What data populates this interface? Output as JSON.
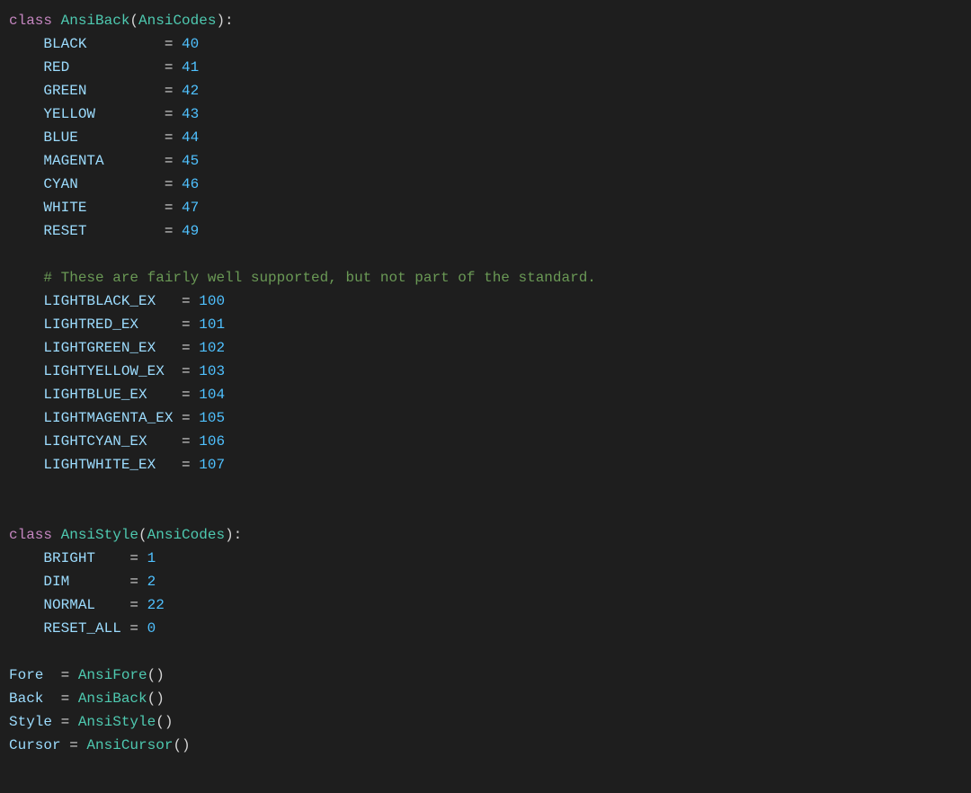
{
  "code": {
    "lines": [
      {
        "type": "class_def",
        "keyword": "class",
        "name": "AnsiBack",
        "parent": "AnsiCodes",
        "suffix": "):"
      },
      {
        "type": "attr",
        "name": "BLACK",
        "value": "40"
      },
      {
        "type": "attr",
        "name": "RED",
        "value": "41"
      },
      {
        "type": "attr",
        "name": "GREEN",
        "value": "42"
      },
      {
        "type": "attr",
        "name": "YELLOW",
        "value": "43"
      },
      {
        "type": "attr",
        "name": "BLUE",
        "value": "44"
      },
      {
        "type": "attr",
        "name": "MAGENTA",
        "value": "45"
      },
      {
        "type": "attr",
        "name": "CYAN",
        "value": "46"
      },
      {
        "type": "attr",
        "name": "WHITE",
        "value": "47"
      },
      {
        "type": "attr",
        "name": "RESET",
        "value": "49"
      },
      {
        "type": "empty"
      },
      {
        "type": "comment",
        "text": "# These are fairly well supported, but not part of the standard."
      },
      {
        "type": "attr",
        "name": "LIGHTBLACK_EX",
        "value": "100"
      },
      {
        "type": "attr",
        "name": "LIGHTRED_EX",
        "value": "101"
      },
      {
        "type": "attr",
        "name": "LIGHTGREEN_EX",
        "value": "102"
      },
      {
        "type": "attr",
        "name": "LIGHTYELLOW_EX",
        "value": "103"
      },
      {
        "type": "attr",
        "name": "LIGHTBLUE_EX",
        "value": "104"
      },
      {
        "type": "attr",
        "name": "LIGHTMAGENTA_EX",
        "value": "105"
      },
      {
        "type": "attr",
        "name": "LIGHTCYAN_EX",
        "value": "106"
      },
      {
        "type": "attr",
        "name": "LIGHTWHITE_EX",
        "value": "107"
      },
      {
        "type": "empty"
      },
      {
        "type": "empty"
      },
      {
        "type": "class_def",
        "keyword": "class",
        "name": "AnsiStyle",
        "parent": "AnsiCodes",
        "suffix": "):"
      },
      {
        "type": "attr",
        "name": "BRIGHT",
        "value": "1"
      },
      {
        "type": "attr",
        "name": "DIM",
        "value": "2"
      },
      {
        "type": "attr",
        "name": "NORMAL",
        "value": "22"
      },
      {
        "type": "attr",
        "name": "RESET_ALL",
        "value": "0"
      },
      {
        "type": "empty"
      },
      {
        "type": "instance",
        "var": "Fore",
        "class": "AnsiFore"
      },
      {
        "type": "instance",
        "var": "Back",
        "class": "AnsiBack"
      },
      {
        "type": "instance",
        "var": "Style",
        "class": "AnsiStyle"
      },
      {
        "type": "instance",
        "var": "Cursor",
        "class": "AnsiCursor"
      }
    ]
  },
  "colors": {
    "background": "#1e1e1e",
    "keyword_class": "#c586c0",
    "class_name": "#4ec9b0",
    "identifier": "#9cdcfe",
    "number": "#4fc1ff",
    "comment": "#6a9955",
    "operator": "#d4d4d4",
    "instance": "#9cdcfe",
    "method": "#dcdcaa"
  }
}
